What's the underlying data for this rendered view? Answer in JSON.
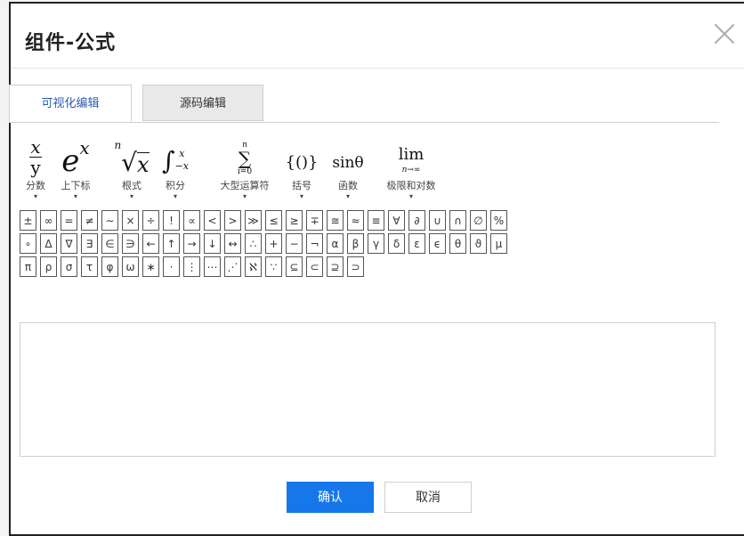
{
  "dialog": {
    "title": "组件-公式",
    "ok_label": "确认",
    "cancel_label": "取消"
  },
  "tabs": [
    {
      "label": "可视化编辑",
      "active": true
    },
    {
      "label": "源码编辑",
      "active": false
    }
  ],
  "groups": [
    {
      "label": "分数",
      "icon": "fraction-icon"
    },
    {
      "label": "上下标",
      "icon": "superscript-icon"
    },
    {
      "label": "根式",
      "icon": "radical-icon"
    },
    {
      "label": "积分",
      "icon": "integral-icon"
    },
    {
      "label": "大型运算符",
      "icon": "summation-icon"
    },
    {
      "label": "括号",
      "icon": "brackets-icon"
    },
    {
      "label": "函数",
      "icon": "function-icon"
    },
    {
      "label": "极限和对数",
      "icon": "limit-icon"
    }
  ],
  "symbols": [
    [
      "±",
      "∞",
      "=",
      "≠",
      "∼",
      "×",
      "÷",
      "!",
      "∝",
      "<",
      ">",
      "≫",
      "≤",
      "≥",
      "∓",
      "≅",
      "≈",
      "≡",
      "∀",
      "∂",
      "∪",
      "∩",
      "∅",
      "%"
    ],
    [
      "∘",
      "Δ",
      "∇",
      "∃",
      "∈",
      "∋",
      "←",
      "↑",
      "→",
      "↓",
      "↔",
      "∴",
      "+",
      "−",
      "¬",
      "α",
      "β",
      "γ",
      "δ",
      "ε",
      "ϵ",
      "θ",
      "ϑ",
      "μ"
    ],
    [
      "π",
      "ρ",
      "σ",
      "τ",
      "φ",
      "ω",
      "∗",
      "·",
      "⋮",
      "⋯",
      "⋰",
      "ℵ",
      "∵",
      "⊆",
      "⊂",
      "⊇",
      "⊃"
    ]
  ],
  "editor": {
    "value": ""
  }
}
